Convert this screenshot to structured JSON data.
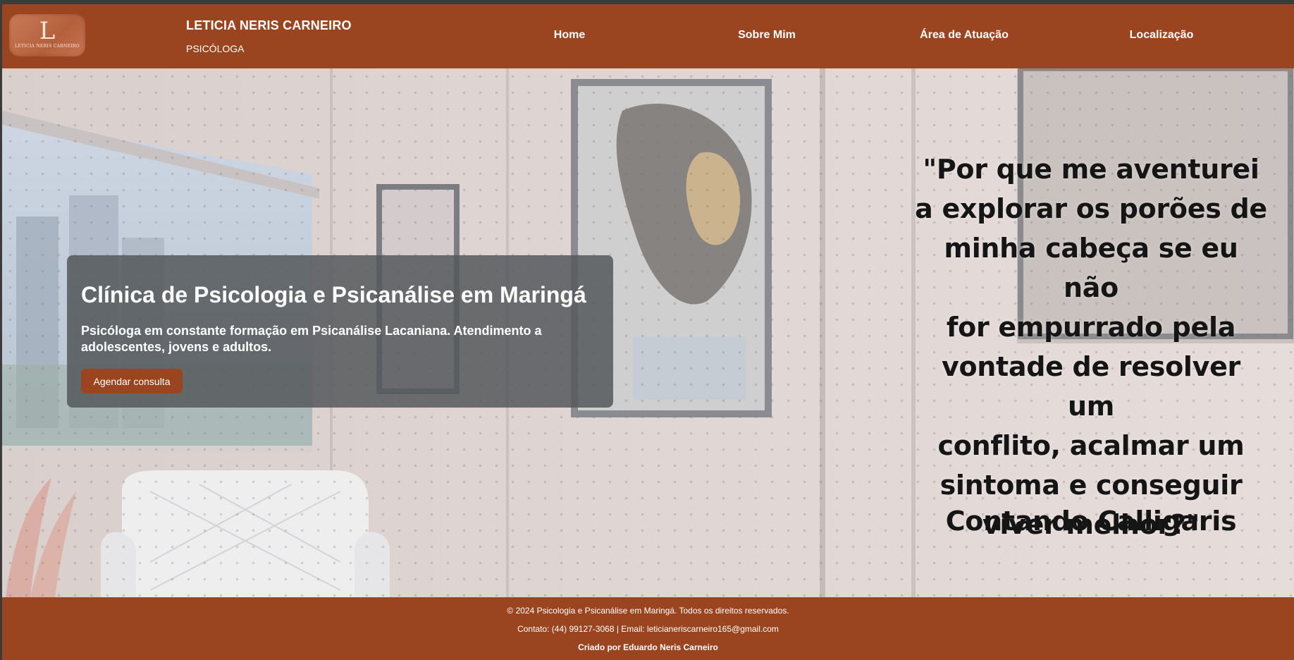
{
  "header": {
    "logo": {
      "letter": "L",
      "text": "LETICIA NERIS CARNEIRO"
    },
    "brand_name": "LETICIA NERIS CARNEIRO",
    "brand_subtitle": "PSICÓLOGA",
    "nav": [
      {
        "label": "Home"
      },
      {
        "label": "Sobre Mim"
      },
      {
        "label": "Área de Atuação"
      },
      {
        "label": "Localização"
      }
    ]
  },
  "hero": {
    "title": "Clínica de Psicologia e Psicanálise em Maringá",
    "description": "Psicóloga em constante formação em Psicanálise Lacaniana. Atendimento a adolescentes, jovens e adultos.",
    "cta_label": "Agendar consulta",
    "quote_lines": [
      "\"Por que me aventurei",
      "a explorar os porões de",
      "minha cabeça se eu não",
      "for empurrado pela",
      "vontade de resolver um",
      "conflito, acalmar um",
      "sintoma e conseguir",
      "viver melhor?\""
    ],
    "quote_author": "Contando Calligaris"
  },
  "footer": {
    "copyright": "© 2024 Psicologia e Psicanálise em Maringá. Todos os direitos reservados.",
    "contact": "Contato: (44) 99127-3068 | Email: leticianeriscarneiro165@gmail.com",
    "credit": "Criado por Eduardo Neris Carneiro"
  },
  "colors": {
    "brand": "#9b4520",
    "card": "#55585c"
  }
}
